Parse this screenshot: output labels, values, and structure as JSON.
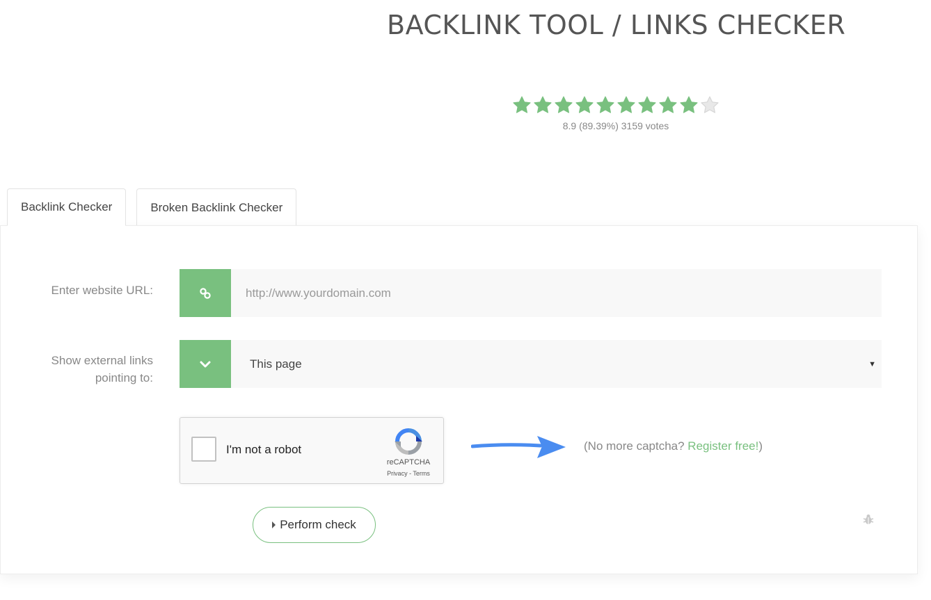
{
  "page": {
    "title": "BACKLINK TOOL / LINKS CHECKER"
  },
  "rating": {
    "stars_total": 10,
    "stars_filled": 9,
    "star_color": "#79c07f",
    "star_empty_color": "#e8e8e8",
    "text": "8.9 (89.39%) 3159 votes"
  },
  "tabs": [
    {
      "label": "Backlink Checker",
      "active": true
    },
    {
      "label": "Broken Backlink Checker",
      "active": false
    }
  ],
  "form": {
    "url_label": "Enter website URL:",
    "url_placeholder": "http://www.yourdomain.com",
    "url_value": "",
    "url_icon": "link-icon",
    "ext_label_line1": "Show external links",
    "ext_label_line2": "pointing to:",
    "ext_icon": "chevron-down-icon",
    "ext_selected": "This page",
    "accent": "#79c07f"
  },
  "captcha": {
    "label": "I'm not a robot",
    "brand": "reCAPTCHA",
    "privacy": "Privacy",
    "separator": " - ",
    "terms": "Terms"
  },
  "register": {
    "prefix": "(No more captcha? ",
    "link": "Register free!",
    "suffix": ")"
  },
  "submit": {
    "label": "Perform check"
  },
  "footer": {
    "bug_icon": "bug-icon"
  }
}
